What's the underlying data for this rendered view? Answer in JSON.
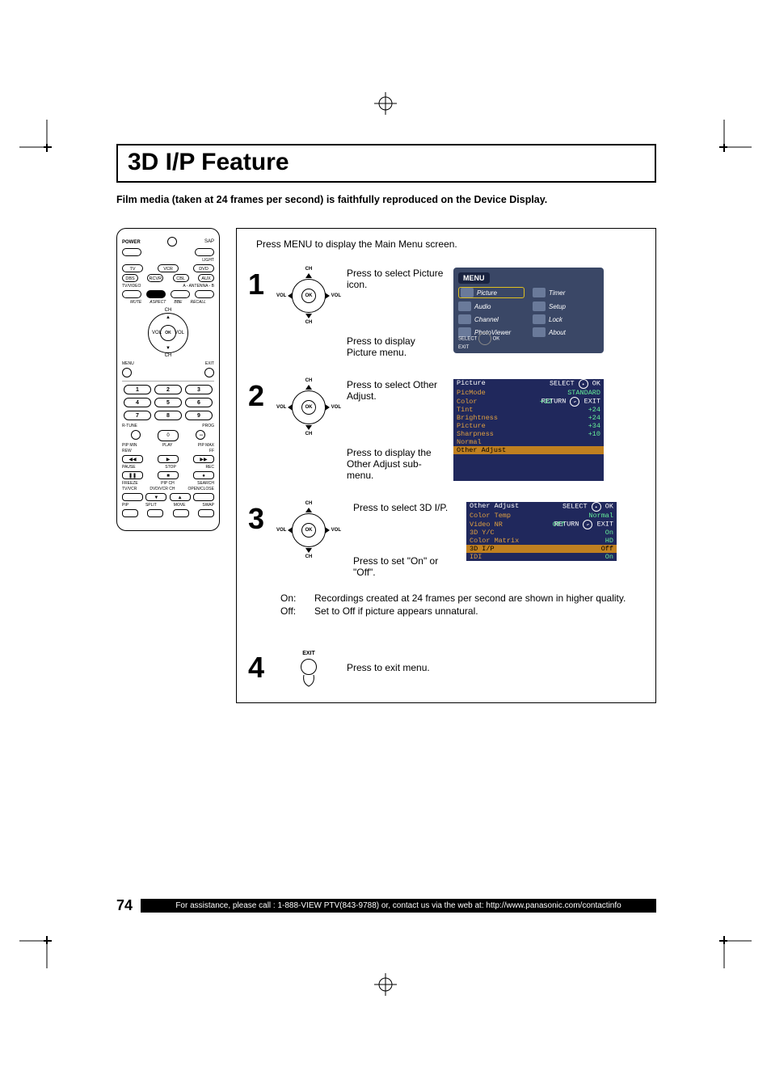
{
  "title": "3D I/P Feature",
  "subtitle": "Film media (taken at 24 frames per second) is faithfully reproduced on the Device Display.",
  "intro": "Press MENU to display the Main Menu screen.",
  "remote": {
    "power": "POWER",
    "sap": "SAP",
    "light": "LIGHT",
    "row1": [
      "TV",
      "VCR",
      "DVD"
    ],
    "row2": [
      "DBS",
      "RCVR",
      "CBL",
      "AUX"
    ],
    "row3l": "TV/VIDEO",
    "row3r": "A - ANTENNA - B",
    "arc": [
      "MUTE",
      "ASPECT",
      "BBE",
      "RECALL"
    ],
    "ch": "CH",
    "vol": "VOL",
    "ok": "OK",
    "menuLbl": "MENU",
    "exitLbl": "EXIT",
    "nums": [
      "1",
      "2",
      "3",
      "4",
      "5",
      "6",
      "7",
      "8",
      "9",
      "0"
    ],
    "rtune": "R-TUNE",
    "prog": "PROG",
    "pipmin": "PIP MIN",
    "play": "PLAY",
    "pipmax": "PIP MAX",
    "rew": "REW",
    "ff": "FF",
    "pause": "PAUSE",
    "stop": "STOP",
    "rec": "REC",
    "freeze": "FREEZE",
    "tvvcr": "TV/VCR",
    "pipch": "PIP CH",
    "dvdvcrch": "DVD/VCR CH",
    "search": "SEARCH",
    "openclose": "OPEN/CLOSE",
    "pip": "PIP",
    "split": "SPLIT",
    "move": "MOVE",
    "swap": "SWAP"
  },
  "dpad": {
    "ok": "OK",
    "ch": "CH",
    "vol": "VOL"
  },
  "steps": {
    "s1": {
      "n": "1",
      "t1": "Press to select Picture icon.",
      "t2": "Press to display Picture menu."
    },
    "s2": {
      "n": "2",
      "t1": "Press to select Other Adjust.",
      "t2": "Press to display the Other Adjust sub-menu."
    },
    "s3": {
      "n": "3",
      "t1": "Press to select 3D I/P.",
      "t2": "Press to set \"On\" or \"Off\".",
      "on_l": "On:",
      "on_t": "Recordings created at 24 frames per second are shown in higher quality.",
      "off_l": "Off:",
      "off_t": "Set to Off if picture appears unnatural."
    },
    "s4": {
      "n": "4",
      "exit": "EXIT",
      "t": "Press to exit menu."
    }
  },
  "menu": {
    "title": "MENU",
    "items": [
      "Picture",
      "Timer",
      "Audio",
      "Setup",
      "Channel",
      "Lock",
      "PhotoViewer",
      "About"
    ],
    "select": "SELECT",
    "ok": "OK",
    "exit": "EXIT"
  },
  "osd1": {
    "title": "Picture",
    "rows": [
      [
        "PicMode",
        "STANDARD"
      ],
      [
        "Color",
        "+32"
      ],
      [
        "Tint",
        "+24"
      ],
      [
        "Brightness",
        "+24"
      ],
      [
        "Picture",
        "+34"
      ],
      [
        "Sharpness",
        "+10"
      ],
      [
        "Normal",
        ""
      ],
      [
        "Other Adjust",
        ""
      ]
    ],
    "nav": {
      "select": "SELECT",
      "ok": "OK",
      "return": "RETURN",
      "exit": "EXIT"
    }
  },
  "osd2": {
    "title": "Other Adjust",
    "rows": [
      [
        "Color Temp",
        "Normal"
      ],
      [
        "Video NR",
        "Off"
      ],
      [
        "3D Y/C",
        "On"
      ],
      [
        "Color Matrix",
        "HD"
      ],
      [
        "3D I/P",
        "Off"
      ],
      [
        "IDI",
        "On"
      ]
    ],
    "nav": {
      "select": "SELECT",
      "ok": "OK",
      "return": "RETURN",
      "exit": "EXIT"
    }
  },
  "page_number": "74",
  "footer": "For assistance, please call : 1-888-VIEW PTV(843-9788) or, contact us via the web at: http://www.panasonic.com/contactinfo"
}
